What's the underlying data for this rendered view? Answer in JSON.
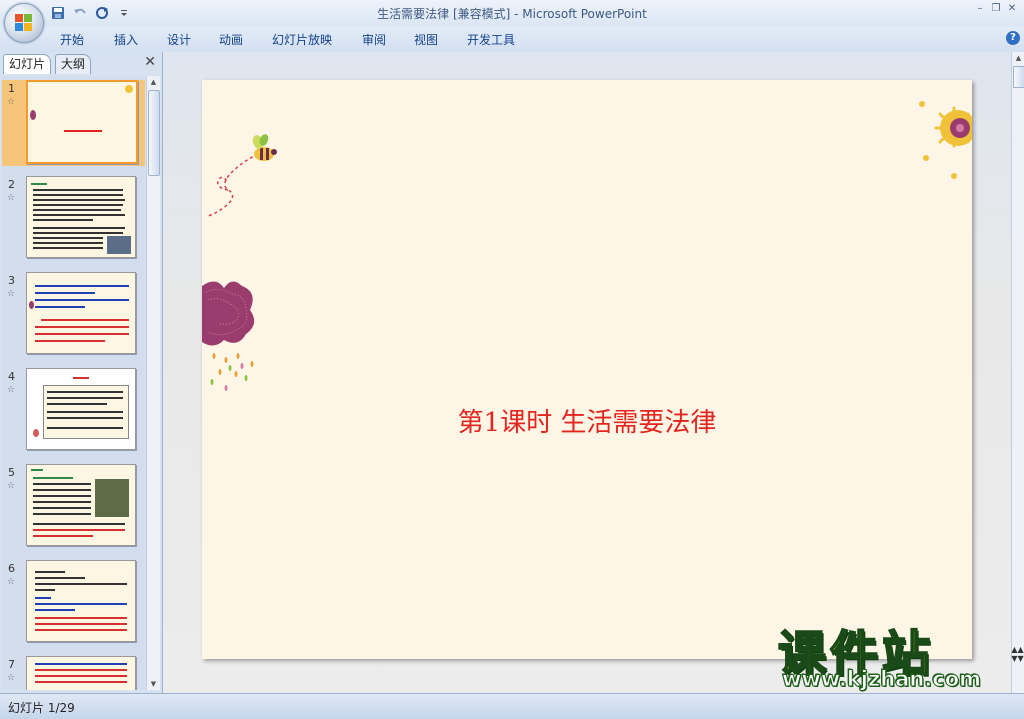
{
  "window": {
    "title": "生活需要法律 [兼容模式] - Microsoft PowerPoint",
    "controls": [
      "–",
      "❐",
      "✕"
    ]
  },
  "quick_access": [
    "save-icon",
    "undo-icon",
    "redo-icon",
    "customize-icon"
  ],
  "ribbon": {
    "tabs": [
      "开始",
      "插入",
      "设计",
      "动画",
      "幻灯片放映",
      "审阅",
      "视图",
      "开发工具"
    ],
    "help": "?"
  },
  "panel": {
    "tabs": [
      "幻灯片",
      "大纲"
    ],
    "close": "✕",
    "slides": [
      {
        "num": "1",
        "selected": true
      },
      {
        "num": "2"
      },
      {
        "num": "3"
      },
      {
        "num": "4"
      },
      {
        "num": "5"
      },
      {
        "num": "6"
      },
      {
        "num": "7"
      }
    ],
    "star": "☆"
  },
  "slide": {
    "title": "第1课时  生活需要法律"
  },
  "status": {
    "text": "幻灯片 1/29"
  },
  "watermark": {
    "big": "课件站",
    "url": "www.kjzhan.com"
  },
  "colors": {
    "accent": "#e2261f",
    "slide_bg": "#fdf6e6",
    "selection": "#f7c57a"
  }
}
